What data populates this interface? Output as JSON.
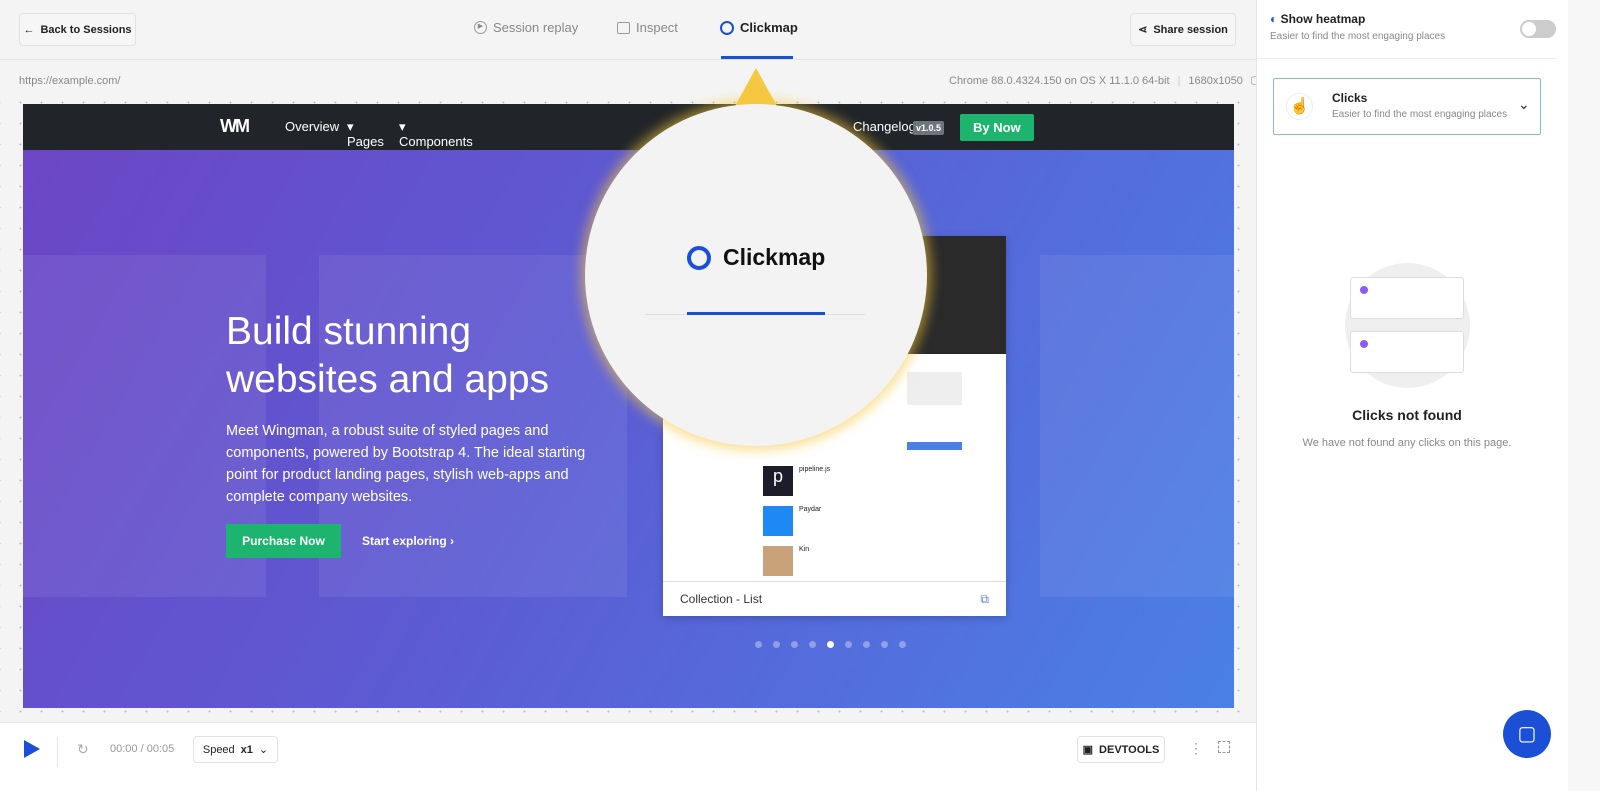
{
  "header": {
    "back_label": "Back to Sessions",
    "share_label": "Share session",
    "tabs": [
      {
        "label": "Session replay",
        "icon": "play-circle-icon"
      },
      {
        "label": "Inspect",
        "icon": "inspect-icon"
      },
      {
        "label": "Clickmap",
        "icon": "clickmap-icon",
        "active": true
      }
    ]
  },
  "info": {
    "url": "https://example.com/",
    "browser": "Chrome 88.0.4324.150 on OS X 11.1.0 64-bit",
    "resolution": "1680x1050"
  },
  "site": {
    "nav": [
      "Overview",
      "Pages",
      "Components"
    ],
    "changelog": "Changelog",
    "version": "v1.0.5",
    "cta": "By Now",
    "headline_1": "Build stunning",
    "headline_2": "websites and apps",
    "lead": "Meet Wingman, a robust suite of styled pages and components, powered by Bootstrap 4. The ideal starting point for product landing pages, stylish web-apps and complete company websites.",
    "purchase": "Purchase Now",
    "explore": "Start exploring",
    "card_caption": "Collection - List",
    "list": [
      {
        "name": "pipeline.js"
      },
      {
        "name": "Paydar"
      },
      {
        "name": "Kin"
      }
    ],
    "carousel_total": 9,
    "carousel_active": 5
  },
  "magnifier": {
    "label": "Clickmap"
  },
  "panel": {
    "heatmap_title": "Show heatmap",
    "heatmap_sub": "Easier to find the most engaging places",
    "heatmap_on": false,
    "select_title": "Clicks",
    "select_sub": "Easier to find the most engaging places",
    "empty_title": "Clicks not found",
    "empty_sub": "We have not found any clicks on this page."
  },
  "player": {
    "time": "00:00 / 00:05",
    "speed_label": "Speed",
    "speed_value": "x1",
    "devtools": "DEVTOOLS"
  },
  "colors": {
    "accent": "#1a4fd6",
    "green": "#1db46f",
    "yellow": "#f5c842"
  }
}
